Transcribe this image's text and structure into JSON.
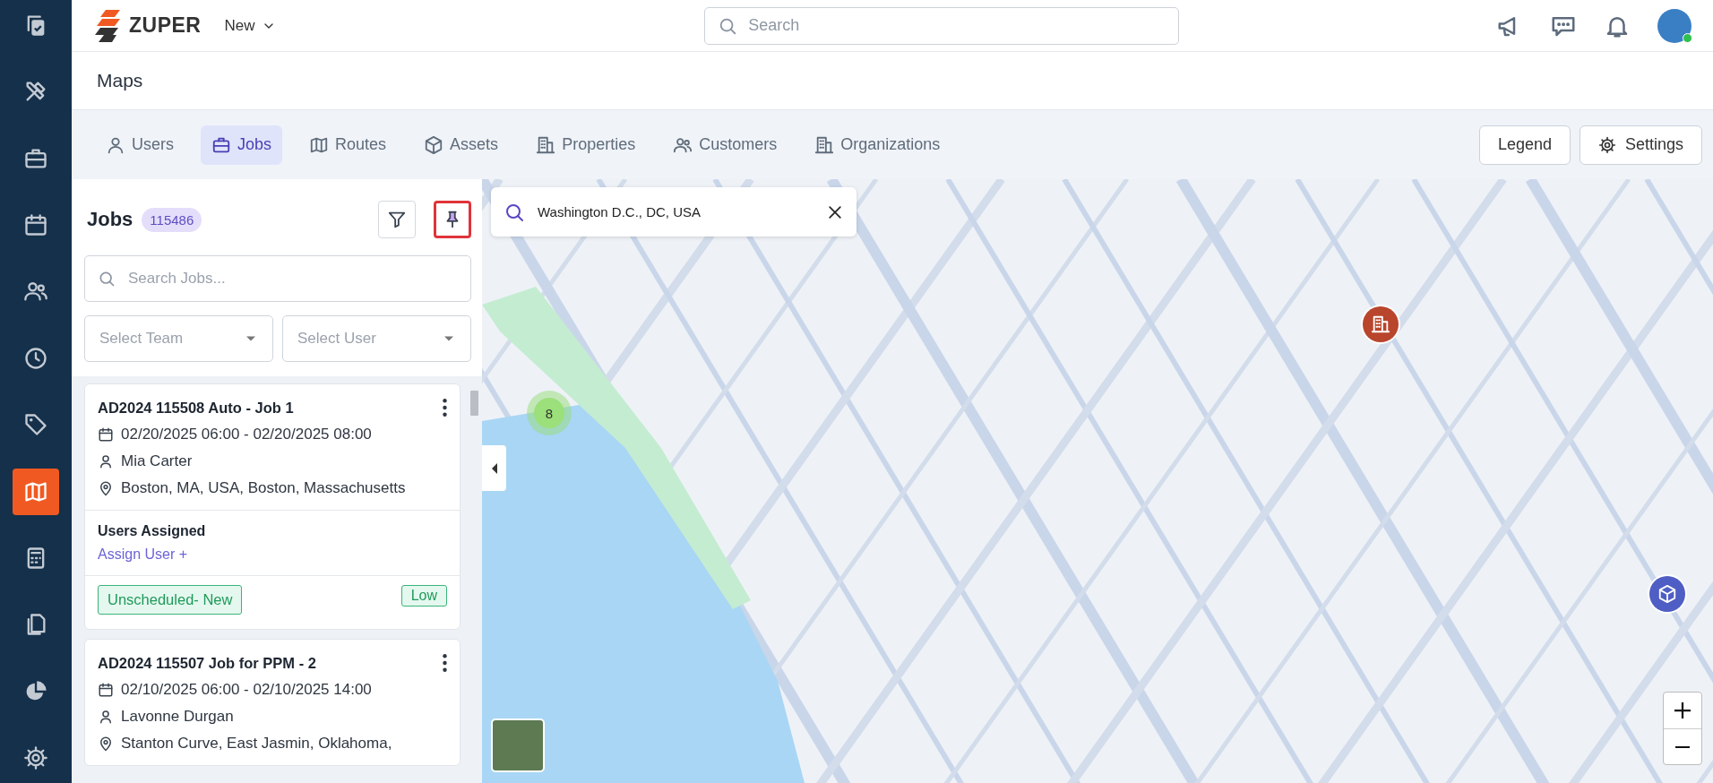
{
  "sidebar": {
    "items": [
      {
        "kind": "copy",
        "selected": false
      },
      {
        "kind": "tools",
        "selected": false
      },
      {
        "kind": "briefcase",
        "selected": false
      },
      {
        "kind": "calendar",
        "selected": false
      },
      {
        "kind": "users",
        "selected": false
      },
      {
        "kind": "clock",
        "selected": false
      },
      {
        "kind": "tag",
        "selected": false
      },
      {
        "kind": "map",
        "selected": true
      },
      {
        "kind": "calculator",
        "selected": false
      },
      {
        "kind": "files",
        "selected": false
      },
      {
        "kind": "pie",
        "selected": false
      },
      {
        "kind": "gear",
        "selected": false
      }
    ]
  },
  "top_bar": {
    "brand": "ZUPER",
    "new_menu": "New",
    "search": {
      "placeholder": "Search"
    }
  },
  "page_title": "Maps",
  "tabs": [
    {
      "label": "Users",
      "kind": "user",
      "selected": false
    },
    {
      "label": "Jobs",
      "kind": "briefcase",
      "selected": true
    },
    {
      "label": "Routes",
      "kind": "map",
      "selected": false
    },
    {
      "label": "Assets",
      "kind": "cube",
      "selected": false
    },
    {
      "label": "Properties",
      "kind": "building",
      "selected": false
    },
    {
      "label": "Customers",
      "kind": "users",
      "selected": false
    },
    {
      "label": "Organizations",
      "kind": "building",
      "selected": false
    }
  ],
  "actions": [
    {
      "label": "Legend",
      "kind": "plain"
    },
    {
      "label": "Settings",
      "kind": "gear"
    }
  ],
  "jobs_panel": {
    "title": "Jobs",
    "count": "115486",
    "pinned": true,
    "search": {
      "placeholder": "Search Jobs..."
    },
    "team_select": {
      "placeholder": "Select Team"
    },
    "user_select": {
      "placeholder": "Select User"
    }
  },
  "jobs": [
    {
      "title": "AD2024 115508 Auto - Job 1",
      "schedule": "02/20/2025 06:00 - 02/20/2025 08:00",
      "customer": "Mia Carter",
      "address": "Boston, MA, USA, Boston, Massachusetts",
      "assigned_label": "Users Assigned",
      "assign_link": "Assign User +",
      "status": "Unscheduled- New",
      "priority": "Low"
    },
    {
      "title": "AD2024 115507 Job for PPM - 2",
      "schedule": "02/10/2025 06:00 - 02/10/2025 14:00",
      "customer": "Lavonne Durgan",
      "address": "Stanton Curve, East Jasmin, Oklahoma,"
    }
  ],
  "map": {
    "search": {
      "value": "Washington D.C., DC, USA"
    },
    "cluster": "8"
  }
}
